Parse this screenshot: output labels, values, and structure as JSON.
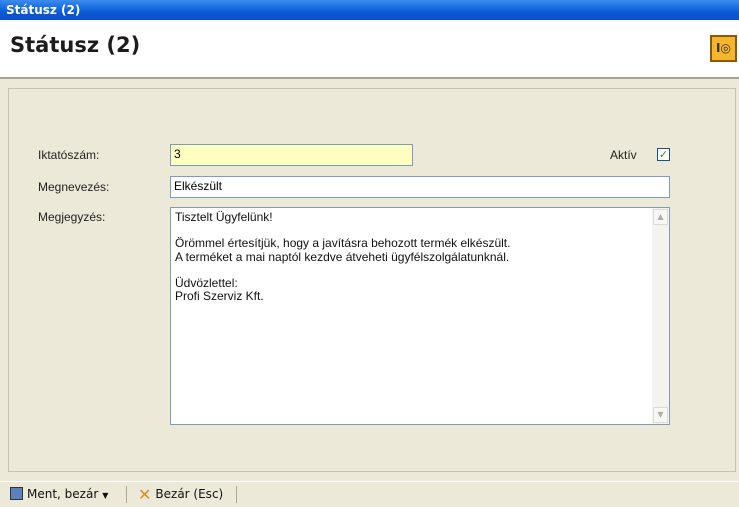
{
  "window": {
    "title": "Státusz (2)"
  },
  "header": {
    "title": "Státusz (2)",
    "icon": "safe-icon"
  },
  "form": {
    "iktatoszam_label": "Iktatószám:",
    "iktatoszam_value": "3",
    "aktiv_label": "Aktív",
    "aktiv_checked": "✓",
    "megnevezes_label": "Megnevezés:",
    "megnevezes_value": "Elkészült",
    "megjegyzes_label": "Megjegyzés:",
    "megjegyzes_value": "Tisztelt Ügyfelünk!\n\nÖrömmel értesítjük, hogy a javításra behozott termék elkészült.\nA terméket a mai naptól kezdve átveheti ügyfélszolgálatunknál.\n\nÜdvözlettel:\nProfi Szerviz Kft."
  },
  "statusbar": {
    "save_label": "Ment, bezár",
    "close_label": "Bezár (Esc)"
  },
  "colors": {
    "title_bar": "#0a5ad6",
    "highlight_input": "#ffffc0"
  }
}
